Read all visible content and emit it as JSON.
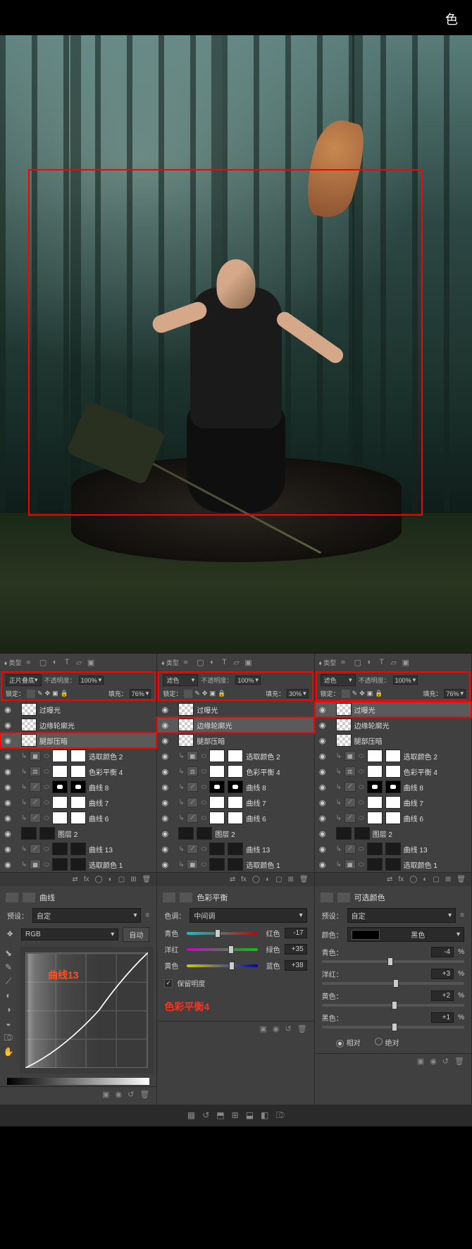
{
  "topbar": {
    "right_char": "色"
  },
  "canvas": {},
  "panels": [
    {
      "type_label": "类型",
      "blend_mode": "正片叠底",
      "opacity_label": "不透明度：",
      "opacity": "100%",
      "lock_label": "锁定：",
      "fill_label": "填充：",
      "fill": "76%",
      "highlight_blend_rows": true,
      "layers": [
        {
          "name": "过曝光",
          "thumb": "trans",
          "sel": false,
          "hl": false
        },
        {
          "name": "边缘轮廓光",
          "thumb": "trans",
          "sel": false,
          "hl": false
        },
        {
          "name": "腿部压暗",
          "thumb": "trans",
          "sel": true,
          "hl": true
        },
        {
          "name": "选取颜色 2",
          "thumb": "white",
          "adj": "sel",
          "mask": "white",
          "sel": false,
          "sub": true
        },
        {
          "name": "色彩平衡 4",
          "thumb": "white",
          "adj": "bal",
          "mask": "white",
          "sel": false,
          "sub": true
        },
        {
          "name": "曲线 8",
          "thumb": "mask",
          "adj": "cur",
          "mask": "mask",
          "sel": false,
          "sub": true
        },
        {
          "name": "曲线 7",
          "thumb": "white",
          "adj": "cur",
          "mask": "white",
          "sel": false,
          "sub": true
        },
        {
          "name": "曲线 6",
          "thumb": "white",
          "adj": "cur",
          "mask": "white",
          "sel": false,
          "sub": true
        },
        {
          "name": "图层 2",
          "thumb": "dark",
          "mask": "dark",
          "sel": false
        },
        {
          "name": "曲线 13",
          "thumb": "dark",
          "adj": "cur",
          "mask": "dark",
          "sel": false,
          "sub": true
        },
        {
          "name": "选取颜色 1",
          "thumb": "dark",
          "adj": "sel",
          "mask": "dark",
          "sel": false,
          "sub": true
        }
      ]
    },
    {
      "type_label": "类型",
      "blend_mode": "滤色",
      "opacity_label": "不透明度：",
      "opacity": "100%",
      "lock_label": "锁定：",
      "fill_label": "填充：",
      "fill": "30%",
      "highlight_blend_rows": true,
      "layers": [
        {
          "name": "过曝光",
          "thumb": "trans",
          "sel": false,
          "hl": false
        },
        {
          "name": "边缘轮廓光",
          "thumb": "trans",
          "sel": true,
          "hl": true
        },
        {
          "name": "腿部压暗",
          "thumb": "trans",
          "sel": false,
          "hl": false
        },
        {
          "name": "选取颜色 2",
          "thumb": "white",
          "adj": "sel",
          "mask": "white",
          "sel": false,
          "sub": true
        },
        {
          "name": "色彩平衡 4",
          "thumb": "white",
          "adj": "bal",
          "mask": "white",
          "sel": false,
          "sub": true
        },
        {
          "name": "曲线 8",
          "thumb": "mask",
          "adj": "cur",
          "mask": "mask",
          "sel": false,
          "sub": true
        },
        {
          "name": "曲线 7",
          "thumb": "white",
          "adj": "cur",
          "mask": "white",
          "sel": false,
          "sub": true
        },
        {
          "name": "曲线 6",
          "thumb": "white",
          "adj": "cur",
          "mask": "white",
          "sel": false,
          "sub": true
        },
        {
          "name": "图层 2",
          "thumb": "dark",
          "mask": "dark",
          "sel": false
        },
        {
          "name": "曲线 13",
          "thumb": "dark",
          "adj": "cur",
          "mask": "dark",
          "sel": false,
          "sub": true
        },
        {
          "name": "选取颜色 1",
          "thumb": "dark",
          "adj": "sel",
          "mask": "dark",
          "sel": false,
          "sub": true
        }
      ]
    },
    {
      "type_label": "类型",
      "blend_mode": "滤色",
      "opacity_label": "不透明度：",
      "opacity": "100%",
      "lock_label": "锁定：",
      "fill_label": "填充：",
      "fill": "76%",
      "highlight_blend_rows": true,
      "layers": [
        {
          "name": "过曝光",
          "thumb": "trans",
          "sel": true,
          "hl": true
        },
        {
          "name": "边缘轮廓光",
          "thumb": "trans",
          "sel": false,
          "hl": false
        },
        {
          "name": "腿部压暗",
          "thumb": "trans",
          "sel": false,
          "hl": false
        },
        {
          "name": "选取颜色 2",
          "thumb": "white",
          "adj": "sel",
          "mask": "white",
          "sel": false,
          "sub": true
        },
        {
          "name": "色彩平衡 4",
          "thumb": "white",
          "adj": "bal",
          "mask": "white",
          "sel": false,
          "sub": true
        },
        {
          "name": "曲线 8",
          "thumb": "mask",
          "adj": "cur",
          "mask": "mask",
          "sel": false,
          "sub": true
        },
        {
          "name": "曲线 7",
          "thumb": "white",
          "adj": "cur",
          "mask": "white",
          "sel": false,
          "sub": true
        },
        {
          "name": "曲线 6",
          "thumb": "white",
          "adj": "cur",
          "mask": "white",
          "sel": false,
          "sub": true
        },
        {
          "name": "图层 2",
          "thumb": "dark",
          "mask": "dark",
          "sel": false
        },
        {
          "name": "曲线 13",
          "thumb": "dark",
          "adj": "cur",
          "mask": "dark",
          "sel": false,
          "sub": true
        },
        {
          "name": "选取颜色 1",
          "thumb": "dark",
          "adj": "sel",
          "mask": "dark",
          "sel": false,
          "sub": true
        }
      ]
    }
  ],
  "curves": {
    "title": "曲线",
    "preset_label": "预设：",
    "preset": "自定",
    "channel": "RGB",
    "auto": "自动",
    "annotation": "曲线13"
  },
  "color_balance": {
    "title": "色彩平衡",
    "tone_label": "色调：",
    "tone": "中间调",
    "sliders": [
      {
        "left": "青色",
        "right": "红色",
        "value": "-17",
        "pos": 44
      },
      {
        "left": "洋红",
        "right": "绿色",
        "value": "+35",
        "pos": 62
      },
      {
        "left": "黄色",
        "right": "蓝色",
        "value": "+38",
        "pos": 63
      }
    ],
    "preserve_lum": "保留明度",
    "annotation": "色彩平衡4"
  },
  "selective_color": {
    "title": "可选颜色",
    "preset_label": "预设：",
    "preset": "自定",
    "color_label": "颜色：",
    "color": "黑色",
    "sliders": [
      {
        "label": "青色：",
        "value": "-4",
        "unit": "%",
        "pos": 48
      },
      {
        "label": "洋红：",
        "value": "+3",
        "unit": "%",
        "pos": 52
      },
      {
        "label": "黄色：",
        "value": "+2",
        "unit": "%",
        "pos": 51
      },
      {
        "label": "黑色：",
        "value": "+1",
        "unit": "%",
        "pos": 51
      }
    ],
    "method": {
      "relative": "相对",
      "absolute": "绝对",
      "selected": "relative"
    }
  }
}
